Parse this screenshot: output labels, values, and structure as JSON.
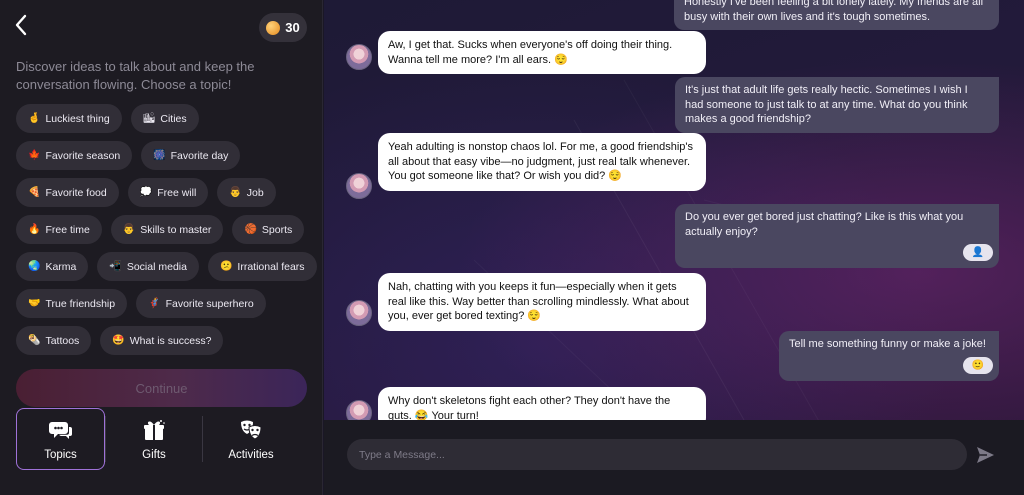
{
  "header": {
    "back_glyph": "‹",
    "coins": "30"
  },
  "intro": "Discover ideas to talk about and keep the conversation flowing. Choose a topic!",
  "topic_rows": [
    [
      {
        "emoji": "🤞",
        "label": "Luckiest thing"
      },
      {
        "emoji": "🏙",
        "label": "Cities"
      }
    ],
    [
      {
        "emoji": "🍁",
        "label": "Favorite season"
      },
      {
        "emoji": "🎆",
        "label": "Favorite day"
      }
    ],
    [
      {
        "emoji": "🍕",
        "label": "Favorite food"
      },
      {
        "emoji": "💭",
        "label": "Free will"
      },
      {
        "emoji": "👨",
        "label": "Job"
      }
    ],
    [
      {
        "emoji": "🔥",
        "label": "Free time"
      },
      {
        "emoji": "👨",
        "label": "Skills to master"
      },
      {
        "emoji": "🏀",
        "label": "Sports"
      }
    ],
    [
      {
        "emoji": "🌏",
        "label": "Karma"
      },
      {
        "emoji": "📲",
        "label": "Social media"
      },
      {
        "emoji": "😕",
        "label": "Irrational fears"
      }
    ],
    [
      {
        "emoji": "🤝",
        "label": "True friendship"
      },
      {
        "emoji": "🦸",
        "label": "Favorite superhero"
      }
    ],
    [
      {
        "emoji": "🌯",
        "label": "Tattoos"
      },
      {
        "emoji": "🤩",
        "label": "What is success?"
      }
    ]
  ],
  "continue_label": "Continue",
  "tabs": [
    {
      "label": "Topics",
      "icon": "chat-bubbles-icon",
      "active": true
    },
    {
      "label": "Gifts",
      "icon": "gift-icon",
      "active": false
    },
    {
      "label": "Activities",
      "icon": "theater-masks-icon",
      "active": false
    }
  ],
  "messages": {
    "m0": "Honestly I've been feeling a bit lonely lately. My friends are all busy with their own lives and it's tough sometimes.",
    "m1": "Aw, I get that. Sucks when everyone's off doing their thing. Wanna tell me more? I'm all ears. 😌",
    "m2": "It's just that adult life gets really hectic. Sometimes I wish I had someone to just talk to at any time. What do you think makes a good friendship?",
    "m3": "Yeah adulting is nonstop chaos lol. For me, a good friendship's all about that easy vibe—no judgment, just real talk whenever. You got someone like that? Or wish you did? 😌",
    "m4": "Do you ever get bored just chatting? Like is this what you actually enjoy?",
    "m4_reaction": "👤",
    "m5": "Nah, chatting with you keeps it fun—especially when it gets real like this. Way better than scrolling mindlessly. What about you, ever get bored texting? 😌",
    "m6": "Tell me something funny or make a joke!",
    "m6_reaction": "🙂",
    "m7": "Why don't skeletons fight each other? They don't have the guts. 😂 Your turn!"
  },
  "composer": {
    "placeholder": "Type a Message..."
  },
  "colors": {
    "accent": "#9f72d8",
    "user_bubble": "#4a4760",
    "bot_bubble": "#ffffff",
    "panel": "#1d1b22"
  }
}
